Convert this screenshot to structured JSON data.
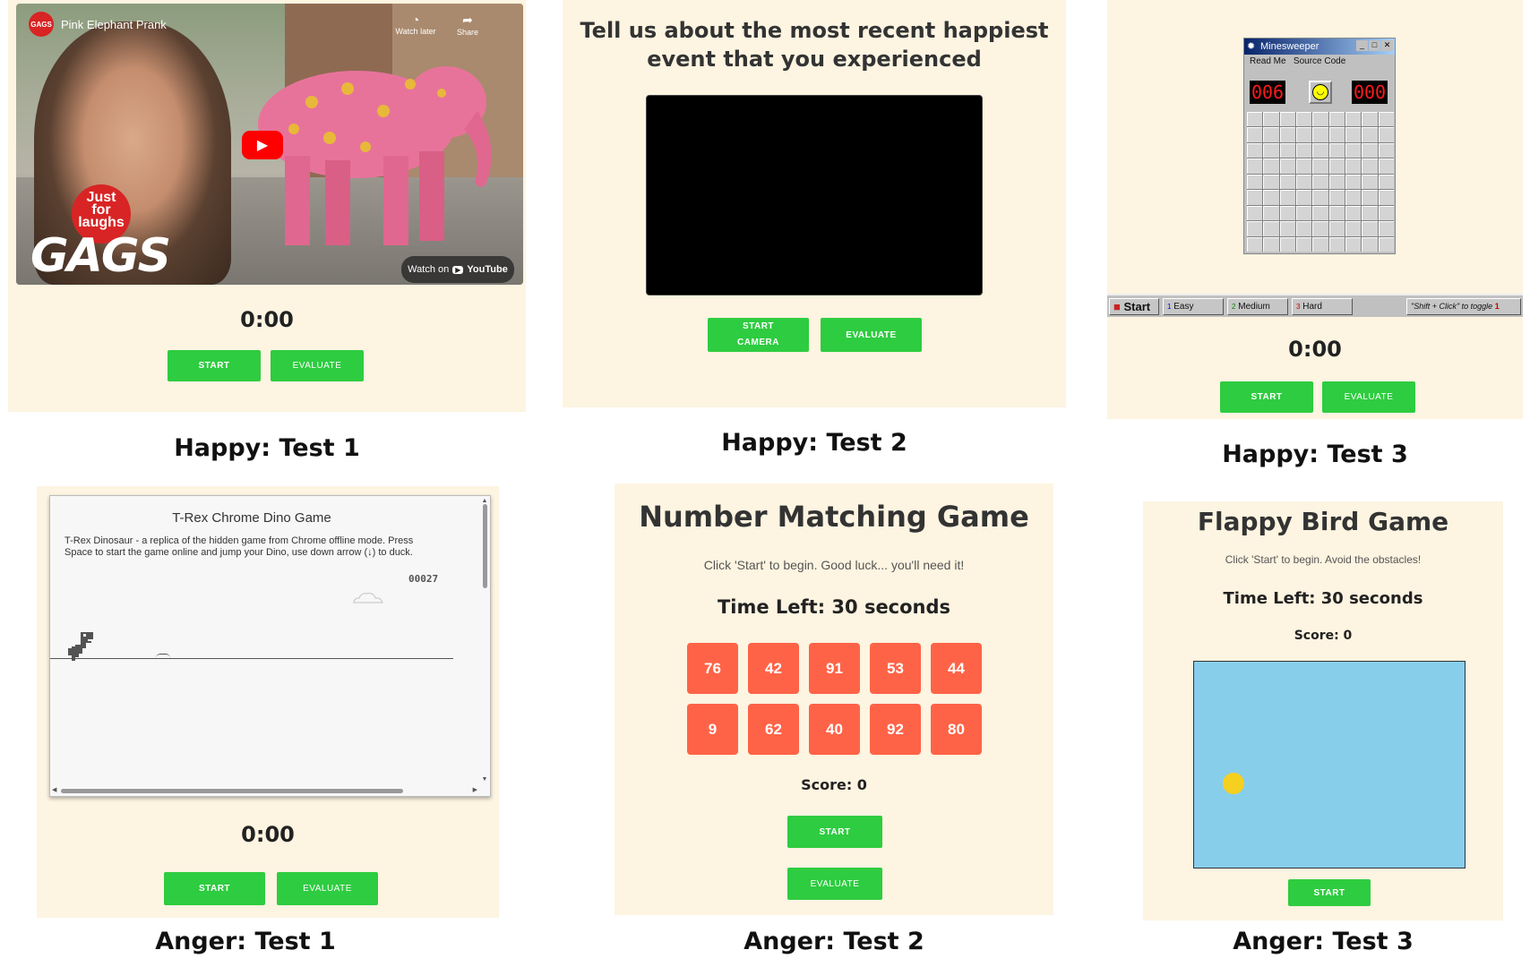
{
  "panels": {
    "happy1": {
      "caption": "Happy: Test 1",
      "video": {
        "channel": "GAGS",
        "title": "Pink Elephant Prank",
        "watch_later": "Watch later",
        "share": "Share",
        "watch_on": "Watch on",
        "youtube": "YouTube",
        "logo_lines": [
          "Just",
          "for",
          "laughs"
        ],
        "logo_gags": "GAGS"
      },
      "timer": "0:00",
      "start": "START",
      "evaluate": "EVALUATE"
    },
    "happy2": {
      "caption": "Happy: Test 2",
      "prompt_line1": "Tell us about the most recent happiest",
      "prompt_line2": "event that you experienced",
      "start_camera_line1": "START",
      "start_camera_line2": "CAMERA",
      "evaluate": "EVALUATE"
    },
    "happy3": {
      "caption": "Happy: Test 3",
      "window_title": "Minesweeper",
      "menu": [
        "Read Me",
        "Source Code"
      ],
      "mines_left": "006",
      "time": "000",
      "taskbar": {
        "start": "Start",
        "easy": "Easy",
        "medium": "Medium",
        "hard": "Hard",
        "toggle": "\"Shift + Click\" to toggle",
        "easy_n": "1",
        "medium_n": "2",
        "hard_n": "3",
        "toggle_n": "1"
      },
      "timer": "0:00",
      "start": "START",
      "evaluate": "EVALUATE"
    },
    "anger1": {
      "caption": "Anger: Test 1",
      "title": "T-Rex Chrome Dino Game",
      "description": "T-Rex Dinosaur - a replica of the hidden game from Chrome offline mode. Press Space to start the game online and jump your Dino, use down arrow (↓) to duck.",
      "score": "00027",
      "timer": "0:00",
      "start": "START",
      "evaluate": "EVALUATE"
    },
    "anger2": {
      "caption": "Anger: Test 2",
      "title": "Number Matching Game",
      "subtitle": "Click 'Start' to begin. Good luck... you'll need it!",
      "time_left": "Time Left: 30 seconds",
      "numbers": [
        "76",
        "42",
        "91",
        "53",
        "44",
        "9",
        "62",
        "40",
        "92",
        "80"
      ],
      "score": "Score: 0",
      "start": "START",
      "evaluate": "EVALUATE"
    },
    "anger3": {
      "caption": "Anger: Test 3",
      "title": "Flappy Bird Game",
      "subtitle": "Click 'Start' to begin. Avoid the obstacles!",
      "time_left": "Time Left: 30 seconds",
      "score": "Score: 0",
      "start": "START"
    }
  },
  "colors": {
    "panel_bg": "#fdf4e1",
    "button": "#2ecc40",
    "tile": "#ff6347",
    "sky": "#87ceeb",
    "bird": "#f5d020"
  }
}
